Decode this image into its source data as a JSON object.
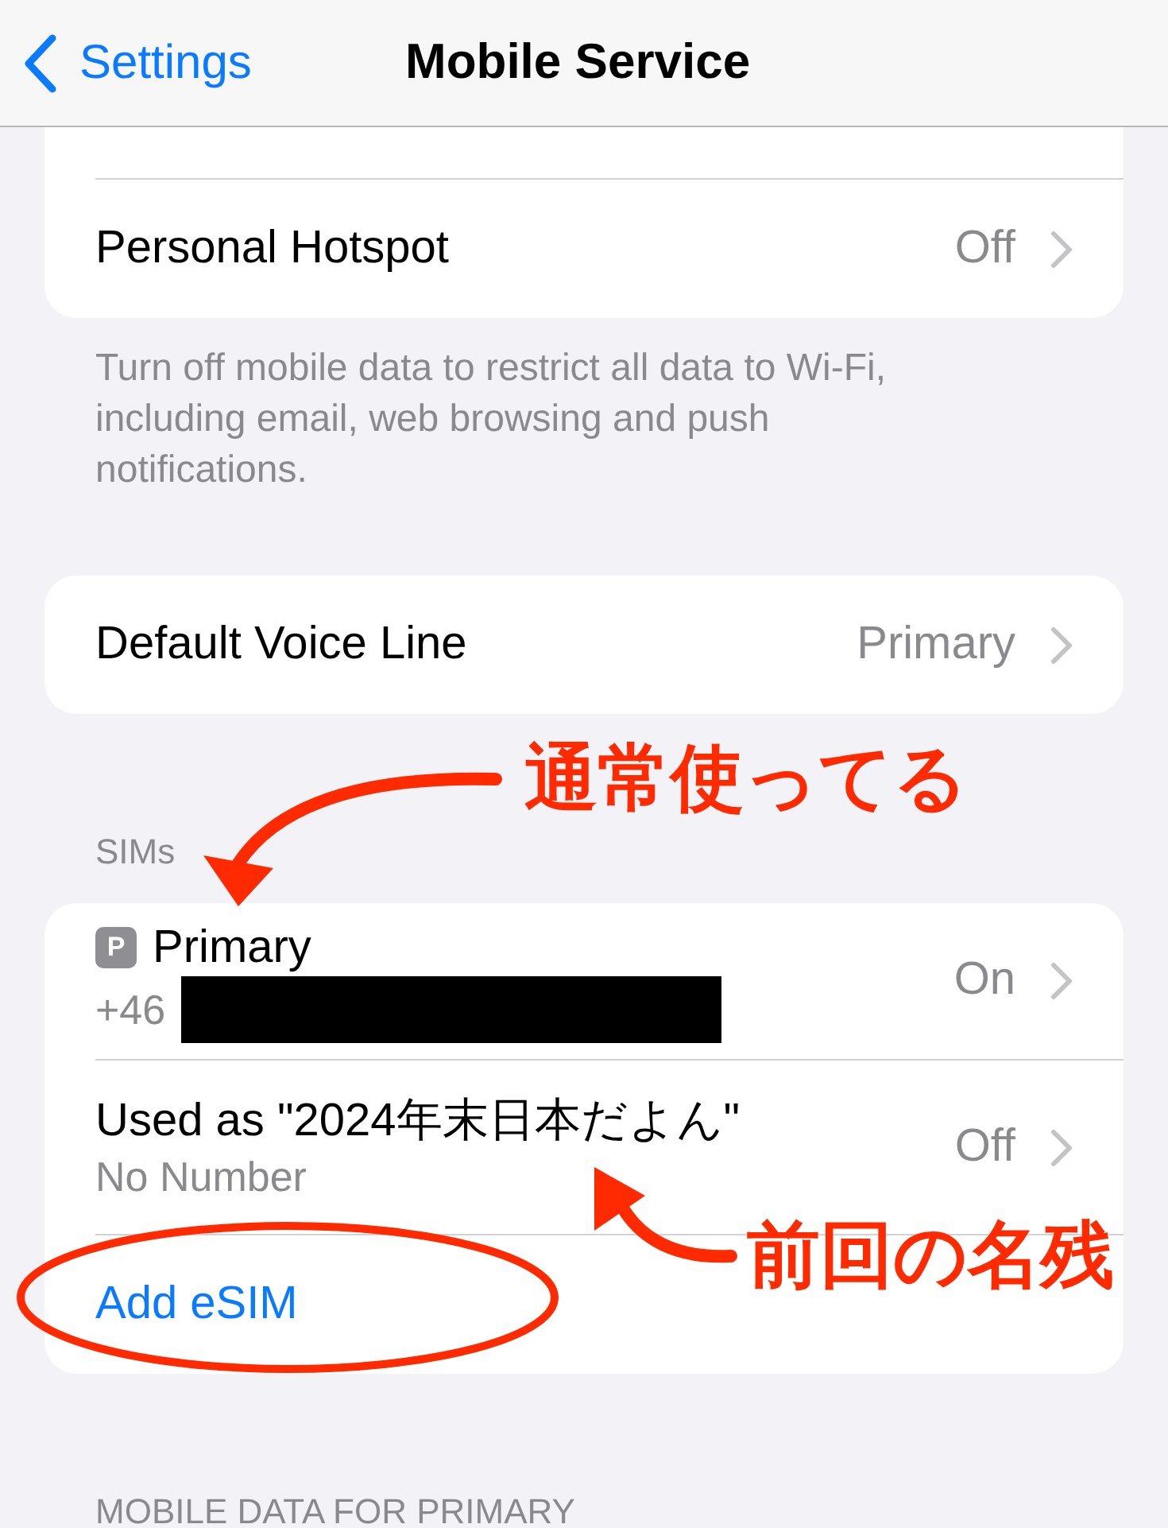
{
  "nav": {
    "back": "Settings",
    "title": "Mobile Service"
  },
  "data_card": [
    {
      "label": "Personal Hotspot",
      "value": "Off"
    }
  ],
  "data_footer": "Turn off mobile data to restrict all data to Wi-Fi, including email, web browsing and push notifications.",
  "voice_card": [
    {
      "label": "Default Voice Line",
      "value": "Primary"
    }
  ],
  "sims_header": "SIMs",
  "sims": [
    {
      "badge": "P",
      "name": "Primary",
      "detail": "+46",
      "redacted": true,
      "status": "On"
    },
    {
      "name": "Used as \"2024年末日本だよん\"",
      "detail": "No Number",
      "redacted": false,
      "status": "Off"
    }
  ],
  "add_esim": "Add eSIM",
  "next_header": "MOBILE DATA FOR PRIMARY",
  "annotations": [
    {
      "kind": "arrow-down",
      "text": "通常使ってる"
    },
    {
      "kind": "arrow-left",
      "text": "前回の名残"
    },
    {
      "kind": "ellipse"
    }
  ]
}
